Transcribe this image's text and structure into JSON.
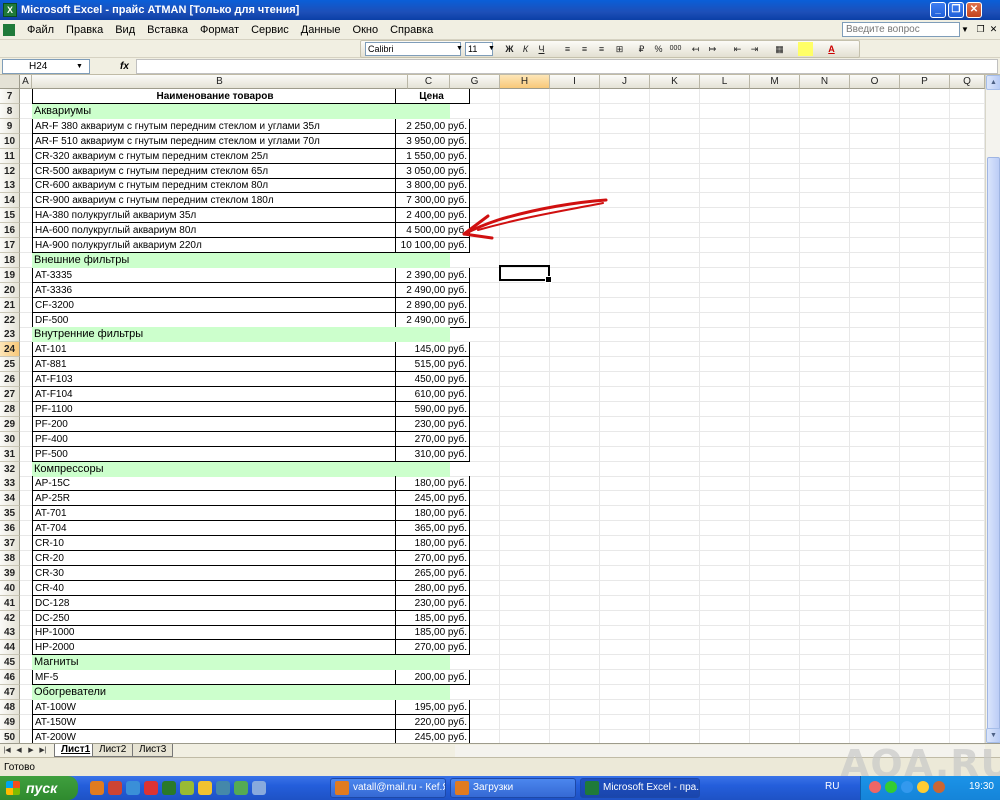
{
  "window": {
    "title": "Microsoft Excel - прайс ATMAN  [Только для чтения]",
    "app_icon": "excel-icon",
    "controls": [
      "_",
      "❐",
      "✕"
    ]
  },
  "menu": {
    "items": [
      "Файл",
      "Правка",
      "Вид",
      "Вставка",
      "Формат",
      "Сервис",
      "Данные",
      "Окно",
      "Справка"
    ],
    "help_placeholder": "Введите вопрос"
  },
  "toolbar": {
    "font_name": "Calibri",
    "font_size": "11",
    "buttons": [
      "Ж",
      "К",
      "Ч",
      "≡",
      "≡",
      "≡",
      "⊞",
      "₽",
      "%",
      "000",
      "↤",
      "↦",
      "⇤",
      "⇥",
      "▦",
      "A"
    ]
  },
  "formula_bar": {
    "name_box": "H24",
    "fx": "fx",
    "value": ""
  },
  "grid": {
    "columns": [
      "A",
      "B",
      "C",
      "G",
      "H",
      "I",
      "J",
      "K",
      "L",
      "M",
      "N",
      "O",
      "P",
      "Q"
    ],
    "selected_column": "H",
    "selected_row": "24",
    "rows": [
      {
        "n": "7",
        "type": "head",
        "b": "Наименование товаров",
        "c": "Цена"
      },
      {
        "n": "8",
        "type": "cat",
        "b": "Аквариумы",
        "c": ""
      },
      {
        "n": "9",
        "type": "item",
        "b": "AR-F 380 аквариум с гнутым передним стеклом и углами 35л",
        "c": "2 250,00 руб."
      },
      {
        "n": "10",
        "type": "item",
        "b": "AR-F 510 аквариум с гнутым передним стеклом и углами 70л",
        "c": "3 950,00 руб."
      },
      {
        "n": "11",
        "type": "item",
        "b": "CR-320 аквариум с гнутым передним стеклом 25л",
        "c": "1 550,00 руб."
      },
      {
        "n": "12",
        "type": "item",
        "b": "CR-500 аквариум с гнутым передним стеклом 65л",
        "c": "3 050,00 руб."
      },
      {
        "n": "13",
        "type": "item",
        "b": "CR-600 аквариум с гнутым передним стеклом 80л",
        "c": "3 800,00 руб."
      },
      {
        "n": "14",
        "type": "item",
        "b": "CR-900 аквариум с гнутым передним стеклом 180л",
        "c": "7 300,00 руб."
      },
      {
        "n": "15",
        "type": "item",
        "b": "HA-380 полукруглый аквариум 35л",
        "c": "2 400,00 руб."
      },
      {
        "n": "16",
        "type": "item",
        "b": "HA-600 полукруглый аквариум 80л",
        "c": "4 500,00 руб."
      },
      {
        "n": "17",
        "type": "item",
        "b": "HA-900 полукруглый аквариум 220л",
        "c": "10 100,00 руб."
      },
      {
        "n": "18",
        "type": "cat",
        "b": "Внешние фильтры",
        "c": ""
      },
      {
        "n": "19",
        "type": "item",
        "b": "AT-3335",
        "c": "2 390,00 руб."
      },
      {
        "n": "20",
        "type": "item",
        "b": "AT-3336",
        "c": "2 490,00 руб."
      },
      {
        "n": "21",
        "type": "item",
        "b": "CF-3200",
        "c": "2 890,00 руб."
      },
      {
        "n": "22",
        "type": "item",
        "b": "DF-500",
        "c": "2 490,00 руб."
      },
      {
        "n": "23",
        "type": "cat",
        "b": "Внутренние фильтры",
        "c": ""
      },
      {
        "n": "24",
        "type": "item",
        "b": "AT-101",
        "c": "145,00 руб."
      },
      {
        "n": "25",
        "type": "item",
        "b": "AT-881",
        "c": "515,00 руб."
      },
      {
        "n": "26",
        "type": "item",
        "b": "AT-F103",
        "c": "450,00 руб."
      },
      {
        "n": "27",
        "type": "item",
        "b": "AT-F104",
        "c": "610,00 руб."
      },
      {
        "n": "28",
        "type": "item",
        "b": "PF-1100",
        "c": "590,00 руб."
      },
      {
        "n": "29",
        "type": "item",
        "b": "PF-200",
        "c": "230,00 руб."
      },
      {
        "n": "30",
        "type": "item",
        "b": "PF-400",
        "c": "270,00 руб."
      },
      {
        "n": "31",
        "type": "item",
        "b": "PF-500",
        "c": "310,00 руб."
      },
      {
        "n": "32",
        "type": "cat",
        "b": "Компрессоры",
        "c": ""
      },
      {
        "n": "33",
        "type": "item",
        "b": "AP-15C",
        "c": "180,00 руб."
      },
      {
        "n": "34",
        "type": "item",
        "b": "AP-25R",
        "c": "245,00 руб."
      },
      {
        "n": "35",
        "type": "item",
        "b": "AT-701",
        "c": "180,00 руб."
      },
      {
        "n": "36",
        "type": "item",
        "b": "AT-704",
        "c": "365,00 руб."
      },
      {
        "n": "37",
        "type": "item",
        "b": "CR-10",
        "c": "180,00 руб."
      },
      {
        "n": "38",
        "type": "item",
        "b": "CR-20",
        "c": "270,00 руб."
      },
      {
        "n": "39",
        "type": "item",
        "b": "CR-30",
        "c": "265,00 руб."
      },
      {
        "n": "40",
        "type": "item",
        "b": "CR-40",
        "c": "280,00 руб."
      },
      {
        "n": "41",
        "type": "item",
        "b": "DC-128",
        "c": "230,00 руб."
      },
      {
        "n": "42",
        "type": "item",
        "b": "DC-250",
        "c": "185,00 руб."
      },
      {
        "n": "43",
        "type": "item",
        "b": "HP-1000",
        "c": "185,00 руб."
      },
      {
        "n": "44",
        "type": "item",
        "b": "HP-2000",
        "c": "270,00 руб."
      },
      {
        "n": "45",
        "type": "cat",
        "b": "Магниты",
        "c": ""
      },
      {
        "n": "46",
        "type": "item",
        "b": "MF-5",
        "c": "200,00 руб."
      },
      {
        "n": "47",
        "type": "cat",
        "b": "Обогреватели",
        "c": ""
      },
      {
        "n": "48",
        "type": "item",
        "b": "AT-100W",
        "c": "195,00 руб."
      },
      {
        "n": "49",
        "type": "item",
        "b": "AT-150W",
        "c": "220,00 руб."
      },
      {
        "n": "50",
        "type": "item",
        "b": "AT-200W",
        "c": "245,00 руб."
      }
    ]
  },
  "sheets": {
    "tabs": [
      "Лист1",
      "Лист2",
      "Лист3"
    ],
    "active": "Лист1"
  },
  "status": {
    "text": "Готово",
    "watermark": "AQA.RU"
  },
  "taskbar": {
    "start_label": "пуск",
    "tasks": [
      {
        "label": "vatall@mail.ru - Кеf.Я...",
        "icon": "firefox-icon"
      },
      {
        "label": "Загрузки",
        "icon": "firefox-icon"
      },
      {
        "label": "Microsoft Excel - пра...",
        "icon": "excel-icon"
      }
    ],
    "language": "RU",
    "clock": "19:30"
  },
  "colors": {
    "category_fill": "#ccffcc",
    "selection_highlight": "#f8c879",
    "annotation_arrow": "#d01010"
  }
}
